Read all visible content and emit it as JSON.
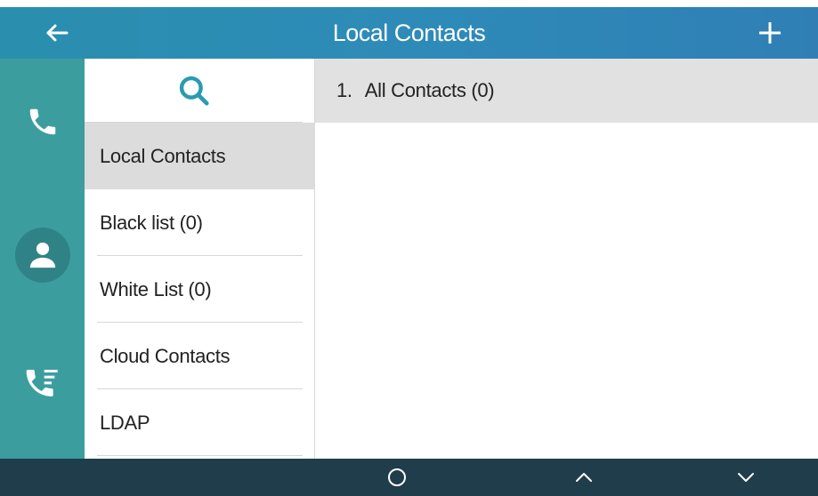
{
  "header": {
    "title": "Local Contacts",
    "back_icon": "arrow-left-icon",
    "add_icon": "plus-icon"
  },
  "sidebar": {
    "items": [
      {
        "icon": "phone-icon",
        "label": "Dialer"
      },
      {
        "icon": "person-icon",
        "label": "Directory",
        "active": true
      },
      {
        "icon": "call-history-icon",
        "label": "History"
      }
    ]
  },
  "groups": {
    "search_icon": "search-icon",
    "items": [
      {
        "label": "Local Contacts",
        "selected": true
      },
      {
        "label": "Black list (0)"
      },
      {
        "label": "White List (0)"
      },
      {
        "label": "Cloud Contacts"
      },
      {
        "label": "LDAP"
      }
    ]
  },
  "contacts": {
    "rows": [
      {
        "number": "1.",
        "label": "All Contacts (0)"
      }
    ]
  },
  "softkeys": [
    {
      "icon": "circle-ok-icon"
    },
    {
      "icon": "chevron-up-icon"
    },
    {
      "icon": "chevron-down-icon"
    }
  ],
  "colors": {
    "titlebar": "#2e8bb8",
    "sidebar": "#3c9d9f",
    "selected_row": "#dcdcdc",
    "bottombar": "#203d4b"
  }
}
